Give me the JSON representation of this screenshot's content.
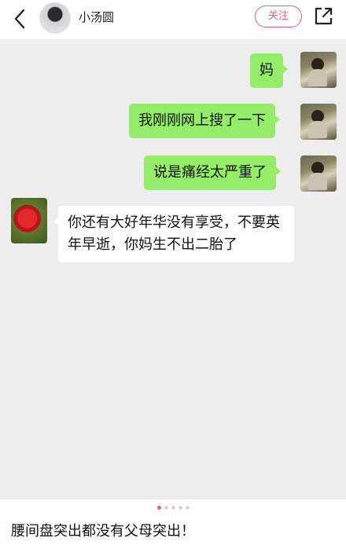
{
  "header": {
    "username": "小汤圆",
    "follow_label": "关注"
  },
  "messages": [
    {
      "side": "right",
      "text": "妈"
    },
    {
      "side": "right",
      "text": "我刚刚网上搜了一下"
    },
    {
      "side": "right",
      "text": "说是痛经太严重了"
    },
    {
      "side": "left",
      "text": "你还有大好年华没有享受，不要英年早逝，你妈生不出二胎了"
    }
  ],
  "pager": {
    "current": 1,
    "total": 5
  },
  "caption": "腰间盘突出都没有父母突出！",
  "colors": {
    "accent": "#f05b74",
    "bubble_sent": "#95ec69",
    "chat_bg": "#ededed"
  },
  "icons": {
    "back": "chevron-left-icon",
    "share": "share-external-icon"
  }
}
